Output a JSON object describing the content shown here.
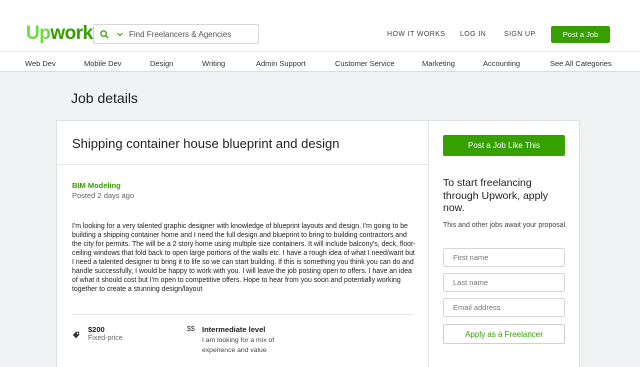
{
  "brand": {
    "logo_up": "Up",
    "logo_work": "work",
    "accent": "#37a000",
    "logo_light": "#6fda44"
  },
  "search": {
    "placeholder": "Find Freelancers & Agencies"
  },
  "nav": {
    "how_it_works": "HOW IT WORKS",
    "login": "LOG IN",
    "signup": "SIGN UP",
    "post_job": "Post a Job"
  },
  "categories": [
    "Web Dev",
    "Mobile Dev",
    "Design",
    "Writing",
    "Admin Support",
    "Customer Service",
    "Marketing",
    "Accounting",
    "See All Categories"
  ],
  "page": {
    "title": "Job details"
  },
  "job": {
    "title": "Shipping container house blueprint and design",
    "category": "BIM Modeling",
    "posted": "Posted 2 days ago",
    "description": "I'm looking for a very talented graphic designer with knowledge of blueprint layouts and design. I'm going to be building a shipping container home and I need the full design and blueprint to bring to building contractors and the city for permits. The will be a 2 story home using multiple size containers. It will include balcony's, deck, floor-ceiling windows that fold back to open large portions of the walls etc. I have a rough idea of what I need/want but I need a talented designer to bring it to life so we can start building. If this is something you think you can do and handle successfully, I would be happy to work with you. I will leave the job posting open to offers. I have an idea of what it should cost but I'm open to competitive offers. Hope to hear from you soon and potentially working together to create a stunning design/layout",
    "price": "$200",
    "price_type": "Fixed-price",
    "level_icon": "$$",
    "level": "Intermediate level",
    "level_desc": "I am looking for a mix of experience and value"
  },
  "sidebar": {
    "post_like_this": "Post a Job Like This",
    "heading": "To start freelancing through Upwork, apply now.",
    "subtext": "This and other jobs await your proposal.",
    "first_name": "First name",
    "last_name": "Last name",
    "email": "Email address",
    "apply": "Apply as a Freelancer"
  }
}
